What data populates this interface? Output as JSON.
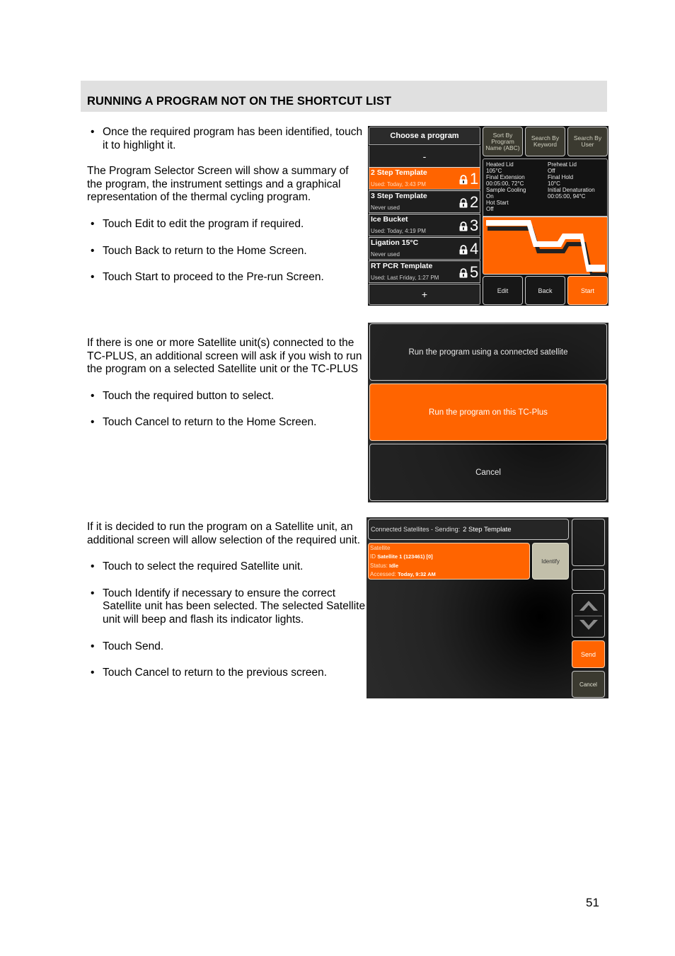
{
  "section": {
    "title": "RUNNING A PROGRAM NOT ON THE SHORTCUT LIST"
  },
  "block1": {
    "bullet1": "Once the required program has been identified, touch it to highlight it.",
    "paragraph": "The Program Selector Screen will show a summary of the program, the instrument settings and a graphical representation of the thermal cycling program.",
    "bullet2": "Touch Edit to edit the program if required.",
    "bullet3": "Touch Back to return to the Home Screen.",
    "bullet4": "Touch Start to proceed to the Pre-run Screen."
  },
  "block2": {
    "paragraph": "If there is one or more Satellite unit(s) connected to the TC-PLUS, an additional screen will ask if you wish to run the program on a selected Satellite unit or the TC-PLUS",
    "bullet1": "Touch the required button to select.",
    "bullet2": "Touch Cancel to return to the Home Screen."
  },
  "block3": {
    "paragraph": "If it is decided to run the program on a Satellite unit, an additional screen will allow selection of the required unit.",
    "bullet1": "Touch to select the required Satellite unit.",
    "bullet2": "Touch Identify if necessary to ensure the correct Satellite unit has been selected. The selected Satellite unit will beep and flash its indicator lights.",
    "bullet3": "Touch Send.",
    "bullet4": "Touch Cancel to return to the previous screen."
  },
  "screen1": {
    "title": "Choose a program",
    "scroll_up": "-",
    "scroll_down": "+",
    "programs": [
      {
        "name": "2 Step Template",
        "used": "Used: Today, 3:43 PM",
        "number": "1",
        "selected": true
      },
      {
        "name": "3 Step Template",
        "used": "Never used",
        "number": "2",
        "selected": false
      },
      {
        "name": "Ice Bucket",
        "used": "Used: Today, 4:19 PM",
        "number": "3",
        "selected": false
      },
      {
        "name": "Ligation 15°C",
        "used": "Never used",
        "number": "4",
        "selected": false
      },
      {
        "name": "RT PCR Template",
        "used": "Used: Last Friday, 1:27 PM",
        "number": "5",
        "selected": false
      }
    ],
    "sort_button": "Sort By Program Name (ABC)",
    "search_keyword_button": "Search By Keyword",
    "search_user_button": "Search By User",
    "settings": [
      {
        "label": "Heated Lid",
        "value": "105°C"
      },
      {
        "label": "Preheat Lid",
        "value": "Off"
      },
      {
        "label": "Final Extension",
        "value": "00:05:00, 72°C"
      },
      {
        "label": "Final Hold",
        "value": "10°C"
      },
      {
        "label": "Sample Cooling",
        "value": "On"
      },
      {
        "label": "Initial Denaturation",
        "value": "00:05:00, 94°C"
      },
      {
        "label": "Hot Start",
        "value": "Off"
      }
    ],
    "edit_button": "Edit",
    "back_button": "Back",
    "start_button": "Start",
    "accent_color": "#ff6400"
  },
  "screen2": {
    "satellite_button": "Run the program using a connected satellite",
    "local_button": "Run the program on this TC-Plus",
    "cancel_button": "Cancel"
  },
  "screen3": {
    "header_label": "Connected Satellites - Sending:",
    "sending_program": "2 Step Template",
    "satellite": {
      "heading": "Satellite",
      "id_label": "ID",
      "id_value": "Satellite 1 (123461) [0]",
      "status_label": "Status:",
      "status_value": "Idle",
      "accessed_label": "Accessed:",
      "accessed_value": "Today, 9:32 AM"
    },
    "identify_button": "Identify",
    "send_button": "Send",
    "cancel_button": "Cancel"
  },
  "page_number": "51"
}
